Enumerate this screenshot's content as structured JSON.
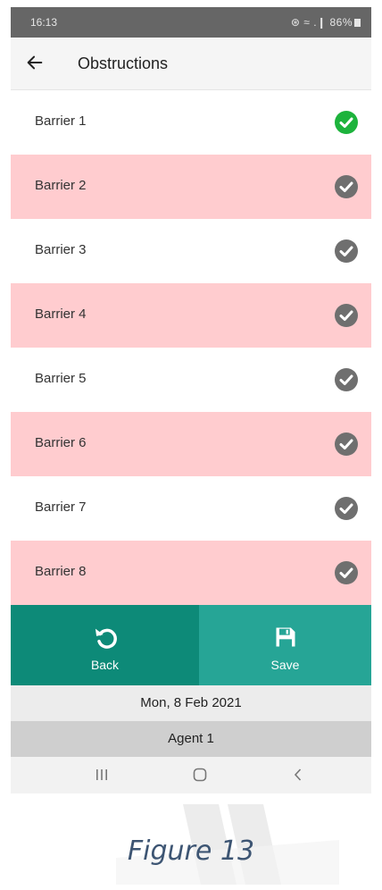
{
  "status_bar": {
    "time": "16:13",
    "indicators": "⊛ ≈ .❙",
    "battery": "86%"
  },
  "header": {
    "title": "Obstructions",
    "back_icon": "arrow-left-icon"
  },
  "items": [
    {
      "label": "Barrier 1",
      "checked": true,
      "row_color": "#ffffff"
    },
    {
      "label": "Barrier 2",
      "checked": false,
      "row_color": "#ffcccf"
    },
    {
      "label": "Barrier 3",
      "checked": false,
      "row_color": "#ffffff"
    },
    {
      "label": "Barrier 4",
      "checked": false,
      "row_color": "#ffcccf"
    },
    {
      "label": "Barrier 5",
      "checked": false,
      "row_color": "#ffffff"
    },
    {
      "label": "Barrier 6",
      "checked": false,
      "row_color": "#ffcccf"
    },
    {
      "label": "Barrier 7",
      "checked": false,
      "row_color": "#ffffff"
    },
    {
      "label": "Barrier 8",
      "checked": false,
      "row_color": "#ffcccf"
    }
  ],
  "actions": {
    "back_label": "Back",
    "save_label": "Save",
    "back_icon": "undo-icon",
    "save_icon": "floppy-disk-icon"
  },
  "date": "Mon, 8 Feb 2021",
  "agent": "Agent 1",
  "colors": {
    "checked": "#1db33c",
    "unchecked": "#6f6f6f",
    "back_button": "#0d8a78",
    "save_button": "#26a596",
    "pink_row": "#ffcccf"
  },
  "caption": "Figure 13"
}
